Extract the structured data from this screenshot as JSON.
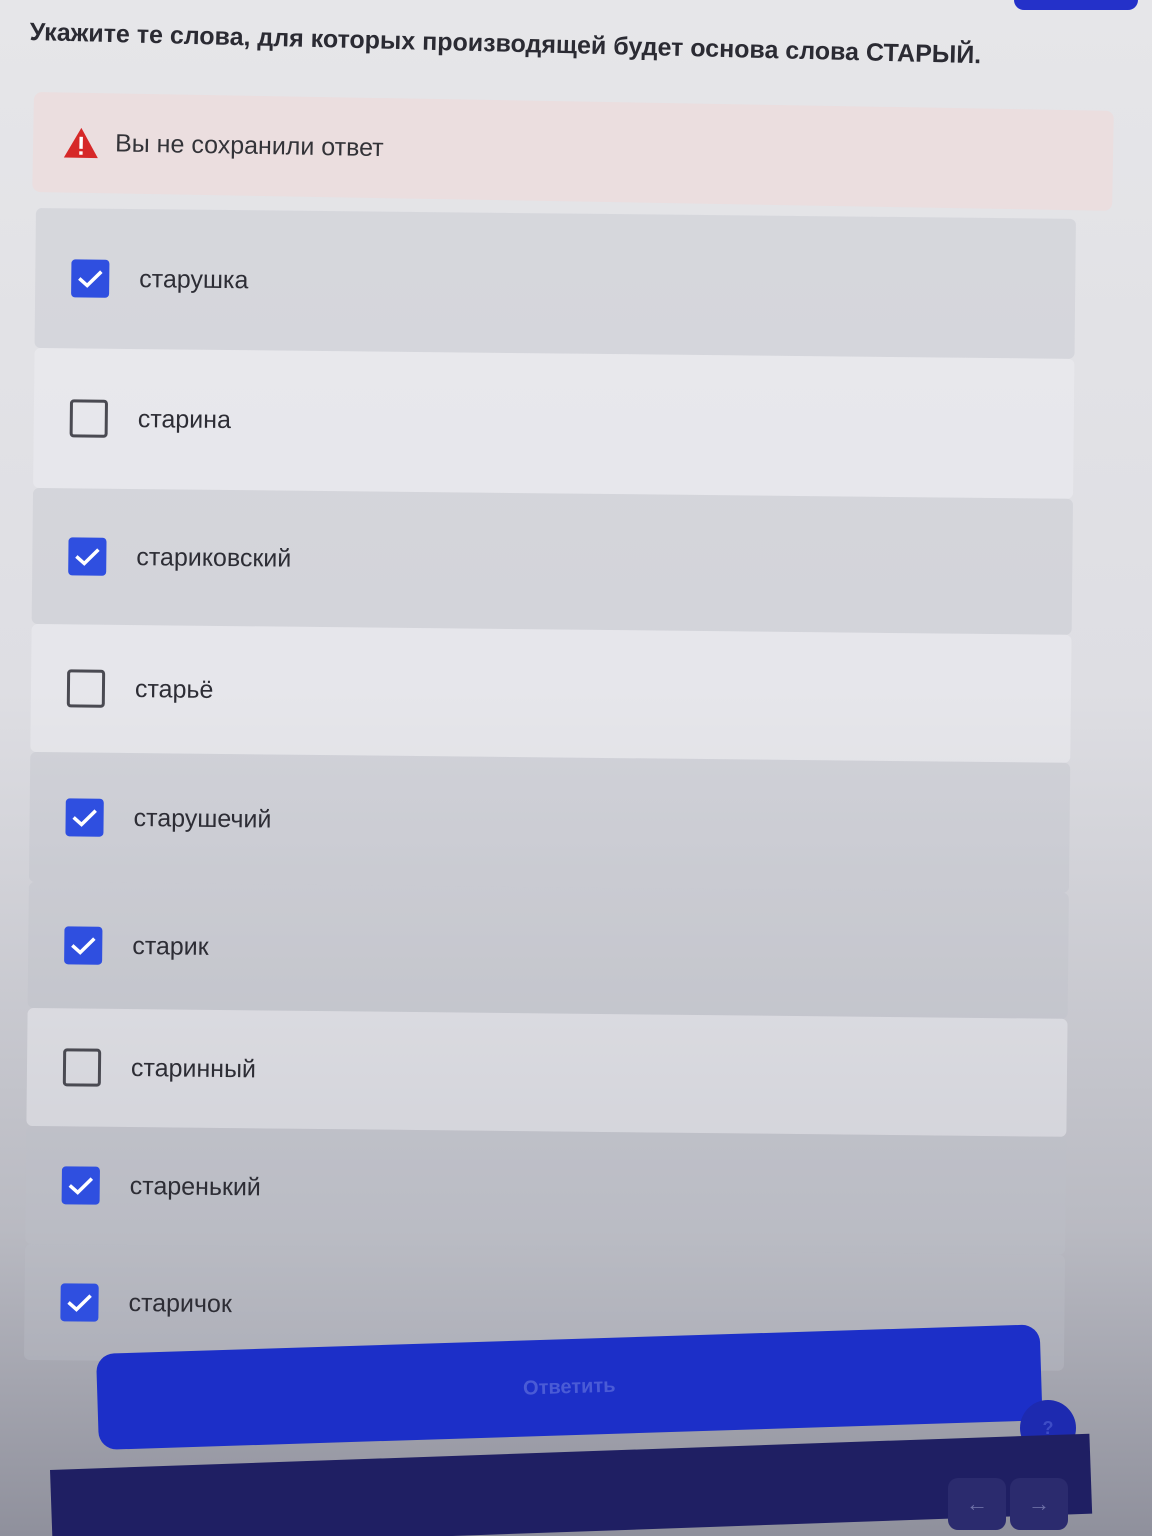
{
  "question": "Укажите те слова, для которых производящей будет основа слова СТАРЫЙ.",
  "alert": {
    "icon": "warning-icon",
    "text": "Вы не сохранили ответ",
    "color": "#d62828"
  },
  "options": [
    {
      "label": "старушка",
      "checked": true
    },
    {
      "label": "старина",
      "checked": false
    },
    {
      "label": "стариковский",
      "checked": true
    },
    {
      "label": "старьё",
      "checked": false
    },
    {
      "label": "старушечий",
      "checked": true
    },
    {
      "label": "старик",
      "checked": true
    },
    {
      "label": "старинный",
      "checked": false
    },
    {
      "label": "старенький",
      "checked": true
    },
    {
      "label": "старичок",
      "checked": true
    }
  ],
  "submit": {
    "label": "Ответить"
  },
  "help": {
    "label": "?"
  },
  "nav": {
    "prev": "←",
    "next": "→"
  },
  "colors": {
    "accent": "#1c2fc8",
    "checkbox": "#2f4fe0",
    "alert_bg": "#ebdedf"
  }
}
